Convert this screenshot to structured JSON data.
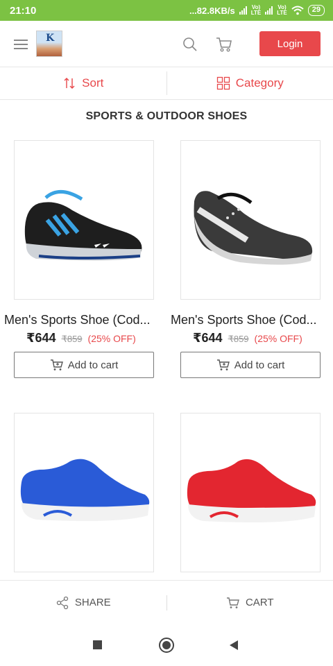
{
  "status_bar": {
    "time": "21:10",
    "network_speed": "...82.8KB/s",
    "sim1_label": "Vo) LTE",
    "sim2_label": "Vo) LTE",
    "battery": "29"
  },
  "header": {
    "logo_letter": "K",
    "login_label": "Login"
  },
  "toolbar": {
    "sort_label": "Sort",
    "category_label": "Category"
  },
  "section_title": "SPORTS & OUTDOOR SHOES",
  "products": [
    {
      "name": "Men's Sports Shoe (Cod...",
      "price": "₹644",
      "mrp": "₹859",
      "discount": "(25% OFF)",
      "add_to_cart": "Add to cart",
      "color": "#222222",
      "accent": "#3aa3e3"
    },
    {
      "name": "Men's Sports Shoe (Cod...",
      "price": "₹644",
      "mrp": "₹859",
      "discount": "(25% OFF)",
      "add_to_cart": "Add to cart",
      "color": "#333333",
      "accent": "#d9d9d9"
    },
    {
      "name": "",
      "color": "#2a5bd7",
      "accent": "#ffffff"
    },
    {
      "name": "",
      "color": "#e32630",
      "accent": "#ffffff"
    }
  ],
  "bottom_bar": {
    "share_label": "SHARE",
    "cart_label": "CART"
  },
  "theme": {
    "status_green": "#7cc243",
    "accent_red": "#e8484b"
  }
}
